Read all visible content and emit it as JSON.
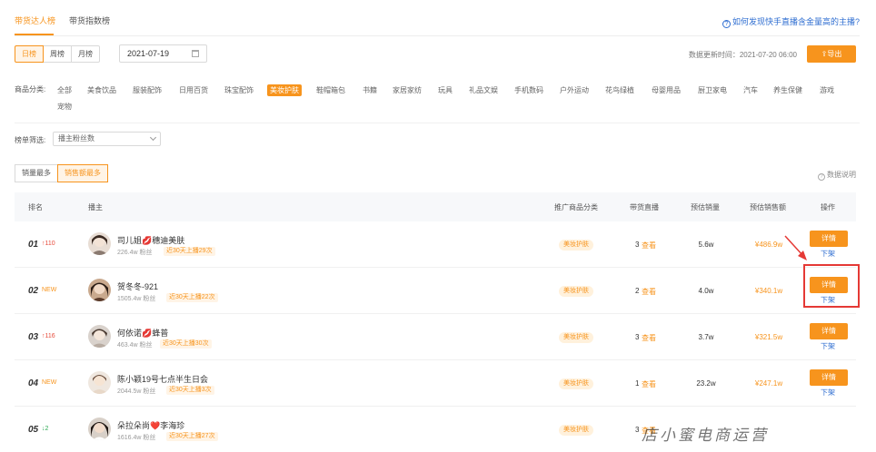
{
  "tabs": [
    "带货达人榜",
    "带货指数榜"
  ],
  "help_link": "如何发现快手直播含金量高的主播?",
  "period_buttons": [
    "日榜",
    "周榜",
    "月榜"
  ],
  "date_value": "2021-07-19",
  "update_time": "数据更新时间：2021-07-20 06:00",
  "export_label": "导出",
  "categories_label": "商品分类:",
  "categories": [
    "全部",
    "美食饮品",
    "服装配饰",
    "日用百货",
    "珠宝配饰",
    "美妆护肤",
    "鞋帽箱包",
    "书籍",
    "家居家纺",
    "玩具",
    "礼品文娱",
    "手机数码",
    "户外运动",
    "花鸟绿植",
    "母婴用品",
    "厨卫家电",
    "汽车",
    "养生保健",
    "游戏",
    "宠物"
  ],
  "active_category": "美妆护肤",
  "filter_label": "榜单筛选:",
  "filter_value": "播主粉丝数",
  "sort_buttons": [
    "销量最多",
    "销售额最多"
  ],
  "data_desc": "数据说明",
  "table_headers": {
    "rank": "排名",
    "streamer": "播主",
    "category": "推广商品分类",
    "live": "带货直播",
    "sales": "预估销量",
    "revenue": "预估销售额",
    "action": "操作"
  },
  "rows": [
    {
      "rank": "01",
      "trend": "↑110",
      "name": "司儿姐💋穗迪美肤",
      "fans": "226.4w 粉丝",
      "live_tag": "近30天上播29次",
      "category": "美妆护肤",
      "live_count": "3",
      "view": "查看",
      "sales": "5.6w",
      "revenue": "¥486.9w",
      "detail": "详情",
      "offshelf": "下架"
    },
    {
      "rank": "02",
      "trend": "NEW",
      "name": "贺冬冬-921",
      "fans": "1505.4w 粉丝",
      "live_tag": "近30天上播22次",
      "category": "美妆护肤",
      "live_count": "2",
      "view": "查看",
      "sales": "4.0w",
      "revenue": "¥340.1w",
      "detail": "详情",
      "offshelf": "下架"
    },
    {
      "rank": "03",
      "trend": "↑116",
      "name": "何依诺💋蜂普",
      "fans": "463.4w 粉丝",
      "live_tag": "近30天上播30次",
      "category": "美妆护肤",
      "live_count": "3",
      "view": "查看",
      "sales": "3.7w",
      "revenue": "¥321.5w",
      "detail": "详情",
      "offshelf": "下架"
    },
    {
      "rank": "04",
      "trend": "NEW",
      "name": "陈小颖19号七点半生日会",
      "fans": "2044.5w 粉丝",
      "live_tag": "近30天上播3次",
      "category": "美妆护肤",
      "live_count": "1",
      "view": "查看",
      "sales": "23.2w",
      "revenue": "¥247.1w",
      "detail": "详情",
      "offshelf": "下架"
    },
    {
      "rank": "05",
      "trend": "↓2",
      "name": "朵拉朵尚❤️李海珍",
      "fans": "1616.4w 粉丝",
      "live_tag": "近30天上播27次",
      "category": "美妆护肤",
      "live_count": "3",
      "view": "查看",
      "sales": "",
      "revenue": "",
      "detail": "",
      "offshelf": ""
    }
  ],
  "watermark": "店小蜜电商运营",
  "colors": {
    "accent": "#f7941d",
    "link": "#2f6ed1",
    "highlight": "#e53935",
    "up": "#e74c3c",
    "down": "#2eaa54"
  }
}
